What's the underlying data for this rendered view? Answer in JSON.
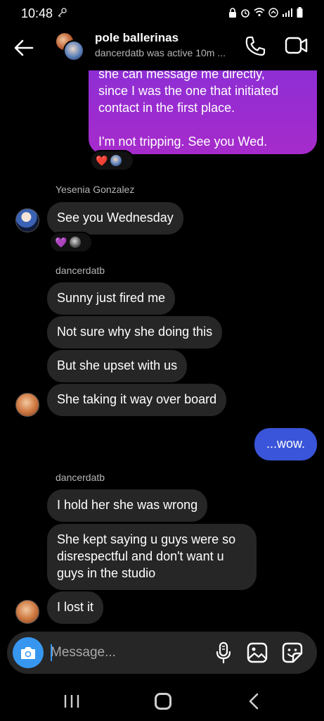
{
  "status_bar": {
    "time": "10:48"
  },
  "header": {
    "title": "pole ballerinas",
    "subtitle": "dancerdatb was active 10m ..."
  },
  "messages": {
    "out_purple": {
      "line1": "she can message me directly,",
      "line2": "since I was the one that initiated",
      "line3": "contact in the first place.",
      "line4": "I'm not tripping. See you Wed."
    },
    "out_purple_reaction": "❤️",
    "yesenia_sender": "Yesenia Gonzalez",
    "yesenia_msg": "See you Wednesday",
    "yesenia_reaction": "💜",
    "group1_sender": "dancerdatb",
    "group1": [
      "Sunny just fired me",
      "Not sure why she doing this",
      "But she upset with us",
      "She taking it way over board"
    ],
    "out_blue": "...wow.",
    "group2_sender": "dancerdatb",
    "group2_a": "I hold her she was wrong",
    "group2_b": {
      "line1": "She kept saying u guys were so",
      "line2": "disrespectful and don't want u",
      "line3": "guys in the studio"
    },
    "group2_c": "I lost it"
  },
  "composer": {
    "placeholder": "Message..."
  },
  "colors": {
    "background": "#000000",
    "incoming_bubble": "#262626",
    "outgoing_purple": "#9b2ccf",
    "outgoing_blue": "#3a55d9",
    "accent": "#3797f0"
  },
  "icons": {
    "back": "arrow-left-icon",
    "call": "phone-icon",
    "video": "video-camera-icon",
    "camera": "camera-icon",
    "mic": "microphone-icon",
    "gallery": "image-icon",
    "sticker": "sticker-icon"
  }
}
